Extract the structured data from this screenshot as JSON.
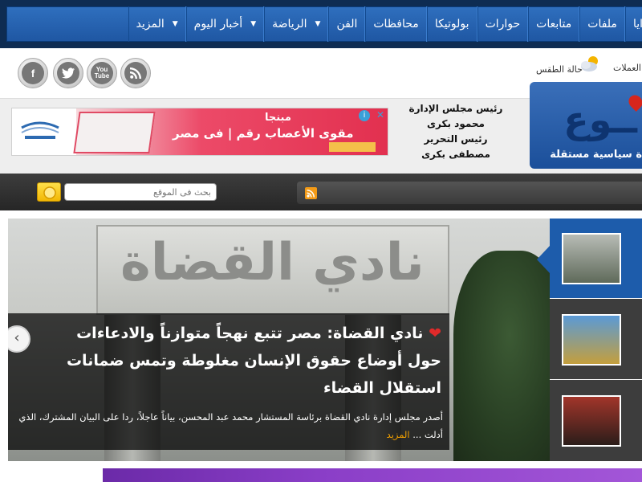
{
  "nav": {
    "items": [
      {
        "label": "ايا",
        "caret": false
      },
      {
        "label": "ملفات",
        "caret": false
      },
      {
        "label": "متابعات",
        "caret": false
      },
      {
        "label": "حوارات",
        "caret": false
      },
      {
        "label": "بولوتيكا",
        "caret": false
      },
      {
        "label": "محافظات",
        "caret": false
      },
      {
        "label": "الفن",
        "caret": false
      },
      {
        "label": "الرياضة",
        "caret": true
      },
      {
        "label": "أخبار اليوم",
        "caret": true
      },
      {
        "label": "المزيد",
        "caret": true
      }
    ]
  },
  "header": {
    "weather_label": "حالة الطقس",
    "currency_label": "العملات",
    "social": [
      "f",
      "t",
      "You Tube",
      "rss"
    ],
    "credits": {
      "line1": "رئيس مجلس الإدارة",
      "line2": "محمود بكرى",
      "line3": "رئيس التحرير",
      "line4": "مصطفى بكرى"
    },
    "logo_text": "ــوع",
    "logo_tagline": "ة سياسية مستقلة"
  },
  "ad": {
    "headline": "مقوى الأعصاب رقم | فى مصر",
    "brand": "مبنجا",
    "info": "i",
    "close": "✕"
  },
  "search": {
    "placeholder": "بحث فى الموقع"
  },
  "slider": {
    "headline": "نادي القضاة: مصر تتبع نهجاً متوازناً والادعاءات حول أوضاع حقوق الإنسان مغلوطة وتمس ضمانات استقلال القضاء",
    "excerpt": "أصدر مجلس إدارة نادي القضاة برئاسة المستشار محمد عبد المحسن، بياناً عاجلاً، ردا على البيان المشترك، الذي أدلت ...",
    "more_label": "المزيد",
    "sign_text": "نادي القضاة",
    "prev_label": "‹"
  },
  "colors": {
    "nav_bg": "#2f6fbe",
    "topbar": "#0e2c52",
    "accent_more": "#f2a000",
    "thumb_active": "#1d5cab"
  }
}
